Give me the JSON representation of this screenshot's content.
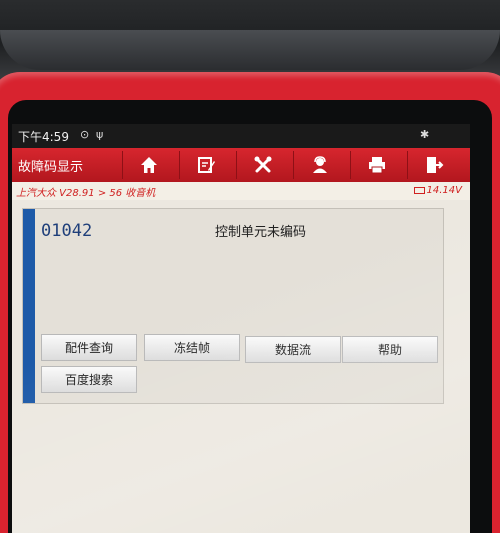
{
  "statusbar": {
    "time": "下午4:59"
  },
  "header": {
    "title": "故障码显示",
    "tools": [
      {
        "icon": "home-icon"
      },
      {
        "icon": "edit-report-icon"
      },
      {
        "icon": "tools-icon"
      },
      {
        "icon": "support-person-icon"
      },
      {
        "icon": "printer-icon"
      },
      {
        "icon": "exit-icon"
      }
    ]
  },
  "subbar": {
    "vehicle": "上汽大众 V28.91 > 56 收音机",
    "voltage": "14.14V"
  },
  "dtc": {
    "code": "01042",
    "description": "控制单元未编码"
  },
  "actions": {
    "parts_lookup": "配件查询",
    "freeze_frame": "冻结帧",
    "data_stream": "数据流",
    "help": "帮助",
    "baidu_search": "百度搜索"
  },
  "colors": {
    "header_red": "#c41e25",
    "accent_blue": "#1d5aa8",
    "frame_red": "#d8232f"
  }
}
